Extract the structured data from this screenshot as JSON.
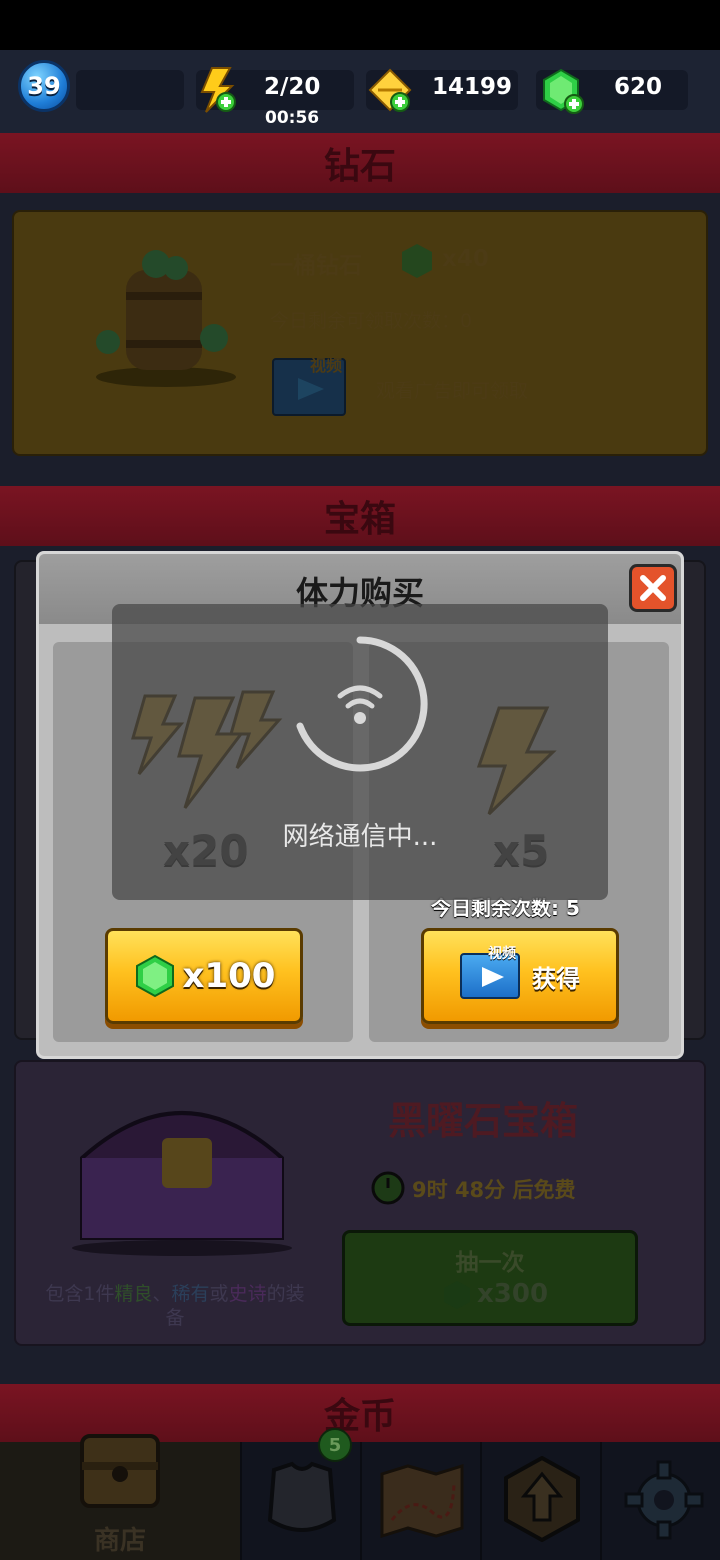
{
  "topbar": {
    "level": "39",
    "energy": {
      "value": "2/20",
      "timer": "00:56",
      "icon": "lightning-plus-icon"
    },
    "coins": {
      "value": "14199",
      "icon": "coin-plus-icon"
    },
    "gems": {
      "value": "620",
      "icon": "gem-plus-icon"
    }
  },
  "sections": {
    "diamonds": {
      "title": "钻石",
      "offer_name": "一桶钻石",
      "offer_amount": "x40",
      "remaining_today": "今日剩余可领取次数：0",
      "video_badge": "视频",
      "watch_ad": "观看广告即可领取"
    },
    "chests": {
      "title": "宝箱",
      "chest_name": "黑曜石宝箱",
      "free_timer_h": "9时",
      "free_timer_m": "48分",
      "free_suffix": "后免费",
      "contains_prefix": "包含1件",
      "contains_q1": "精良",
      "contains_sep1": "、",
      "contains_q2": "稀有",
      "contains_sep2": "或",
      "contains_q3": "史诗",
      "contains_suffix": "的装",
      "contains_line2": "备",
      "draw_label": "抽一次",
      "draw_price": "x300"
    },
    "gold": {
      "title": "金币"
    }
  },
  "dialog": {
    "title": "体力购买",
    "option_gems": {
      "amount": "x20",
      "price": "x100"
    },
    "option_video": {
      "amount": "x5",
      "remaining": "今日剩余次数: 5",
      "video_badge": "视频",
      "button_label": "获得"
    },
    "loading_text": "网络通信中..."
  },
  "navbar": {
    "shop_label": "商店",
    "equipment_badge": "5",
    "items": [
      "shop-chest-icon",
      "armor-icon",
      "map-icon",
      "upgrade-arrow-icon",
      "gear-icon"
    ]
  },
  "colors": {
    "banner_red": "#7a1422",
    "button_gold": "#ffc11f",
    "gem_green": "#2fcf46",
    "close_red": "#e4532b"
  }
}
